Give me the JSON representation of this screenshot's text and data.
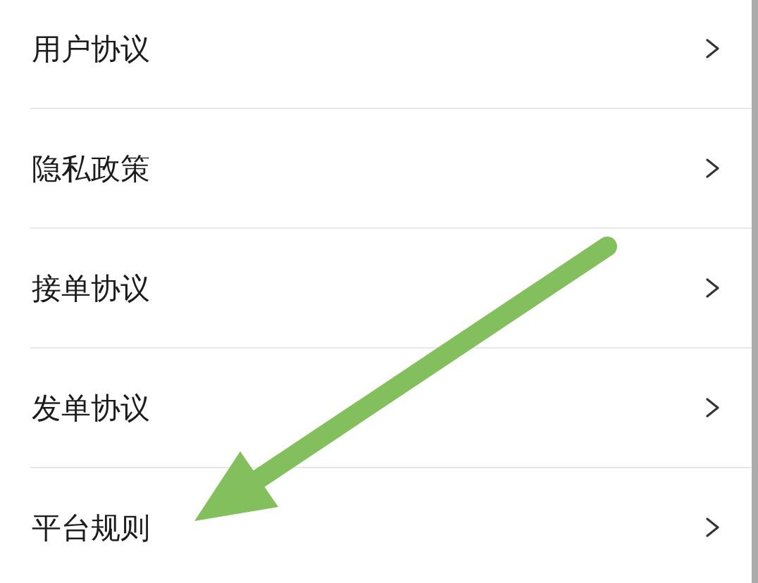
{
  "menu": {
    "items": [
      {
        "label": "用户协议"
      },
      {
        "label": "隐私政策"
      },
      {
        "label": "接单协议"
      },
      {
        "label": "发单协议"
      },
      {
        "label": "平台规则"
      }
    ]
  }
}
